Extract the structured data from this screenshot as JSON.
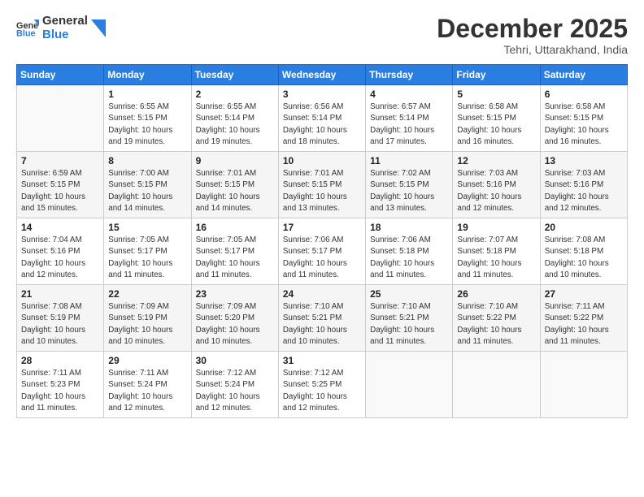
{
  "logo": {
    "line1": "General",
    "line2": "Blue"
  },
  "header": {
    "month": "December 2025",
    "location": "Tehri, Uttarakhand, India"
  },
  "days_of_week": [
    "Sunday",
    "Monday",
    "Tuesday",
    "Wednesday",
    "Thursday",
    "Friday",
    "Saturday"
  ],
  "weeks": [
    [
      {
        "day": "",
        "info": ""
      },
      {
        "day": "1",
        "info": "Sunrise: 6:55 AM\nSunset: 5:15 PM\nDaylight: 10 hours\nand 19 minutes."
      },
      {
        "day": "2",
        "info": "Sunrise: 6:55 AM\nSunset: 5:14 PM\nDaylight: 10 hours\nand 19 minutes."
      },
      {
        "day": "3",
        "info": "Sunrise: 6:56 AM\nSunset: 5:14 PM\nDaylight: 10 hours\nand 18 minutes."
      },
      {
        "day": "4",
        "info": "Sunrise: 6:57 AM\nSunset: 5:14 PM\nDaylight: 10 hours\nand 17 minutes."
      },
      {
        "day": "5",
        "info": "Sunrise: 6:58 AM\nSunset: 5:15 PM\nDaylight: 10 hours\nand 16 minutes."
      },
      {
        "day": "6",
        "info": "Sunrise: 6:58 AM\nSunset: 5:15 PM\nDaylight: 10 hours\nand 16 minutes."
      }
    ],
    [
      {
        "day": "7",
        "info": "Sunrise: 6:59 AM\nSunset: 5:15 PM\nDaylight: 10 hours\nand 15 minutes."
      },
      {
        "day": "8",
        "info": "Sunrise: 7:00 AM\nSunset: 5:15 PM\nDaylight: 10 hours\nand 14 minutes."
      },
      {
        "day": "9",
        "info": "Sunrise: 7:01 AM\nSunset: 5:15 PM\nDaylight: 10 hours\nand 14 minutes."
      },
      {
        "day": "10",
        "info": "Sunrise: 7:01 AM\nSunset: 5:15 PM\nDaylight: 10 hours\nand 13 minutes."
      },
      {
        "day": "11",
        "info": "Sunrise: 7:02 AM\nSunset: 5:15 PM\nDaylight: 10 hours\nand 13 minutes."
      },
      {
        "day": "12",
        "info": "Sunrise: 7:03 AM\nSunset: 5:16 PM\nDaylight: 10 hours\nand 12 minutes."
      },
      {
        "day": "13",
        "info": "Sunrise: 7:03 AM\nSunset: 5:16 PM\nDaylight: 10 hours\nand 12 minutes."
      }
    ],
    [
      {
        "day": "14",
        "info": "Sunrise: 7:04 AM\nSunset: 5:16 PM\nDaylight: 10 hours\nand 12 minutes."
      },
      {
        "day": "15",
        "info": "Sunrise: 7:05 AM\nSunset: 5:17 PM\nDaylight: 10 hours\nand 11 minutes."
      },
      {
        "day": "16",
        "info": "Sunrise: 7:05 AM\nSunset: 5:17 PM\nDaylight: 10 hours\nand 11 minutes."
      },
      {
        "day": "17",
        "info": "Sunrise: 7:06 AM\nSunset: 5:17 PM\nDaylight: 10 hours\nand 11 minutes."
      },
      {
        "day": "18",
        "info": "Sunrise: 7:06 AM\nSunset: 5:18 PM\nDaylight: 10 hours\nand 11 minutes."
      },
      {
        "day": "19",
        "info": "Sunrise: 7:07 AM\nSunset: 5:18 PM\nDaylight: 10 hours\nand 11 minutes."
      },
      {
        "day": "20",
        "info": "Sunrise: 7:08 AM\nSunset: 5:18 PM\nDaylight: 10 hours\nand 10 minutes."
      }
    ],
    [
      {
        "day": "21",
        "info": "Sunrise: 7:08 AM\nSunset: 5:19 PM\nDaylight: 10 hours\nand 10 minutes."
      },
      {
        "day": "22",
        "info": "Sunrise: 7:09 AM\nSunset: 5:19 PM\nDaylight: 10 hours\nand 10 minutes."
      },
      {
        "day": "23",
        "info": "Sunrise: 7:09 AM\nSunset: 5:20 PM\nDaylight: 10 hours\nand 10 minutes."
      },
      {
        "day": "24",
        "info": "Sunrise: 7:10 AM\nSunset: 5:21 PM\nDaylight: 10 hours\nand 10 minutes."
      },
      {
        "day": "25",
        "info": "Sunrise: 7:10 AM\nSunset: 5:21 PM\nDaylight: 10 hours\nand 11 minutes."
      },
      {
        "day": "26",
        "info": "Sunrise: 7:10 AM\nSunset: 5:22 PM\nDaylight: 10 hours\nand 11 minutes."
      },
      {
        "day": "27",
        "info": "Sunrise: 7:11 AM\nSunset: 5:22 PM\nDaylight: 10 hours\nand 11 minutes."
      }
    ],
    [
      {
        "day": "28",
        "info": "Sunrise: 7:11 AM\nSunset: 5:23 PM\nDaylight: 10 hours\nand 11 minutes."
      },
      {
        "day": "29",
        "info": "Sunrise: 7:11 AM\nSunset: 5:24 PM\nDaylight: 10 hours\nand 12 minutes."
      },
      {
        "day": "30",
        "info": "Sunrise: 7:12 AM\nSunset: 5:24 PM\nDaylight: 10 hours\nand 12 minutes."
      },
      {
        "day": "31",
        "info": "Sunrise: 7:12 AM\nSunset: 5:25 PM\nDaylight: 10 hours\nand 12 minutes."
      },
      {
        "day": "",
        "info": ""
      },
      {
        "day": "",
        "info": ""
      },
      {
        "day": "",
        "info": ""
      }
    ]
  ]
}
